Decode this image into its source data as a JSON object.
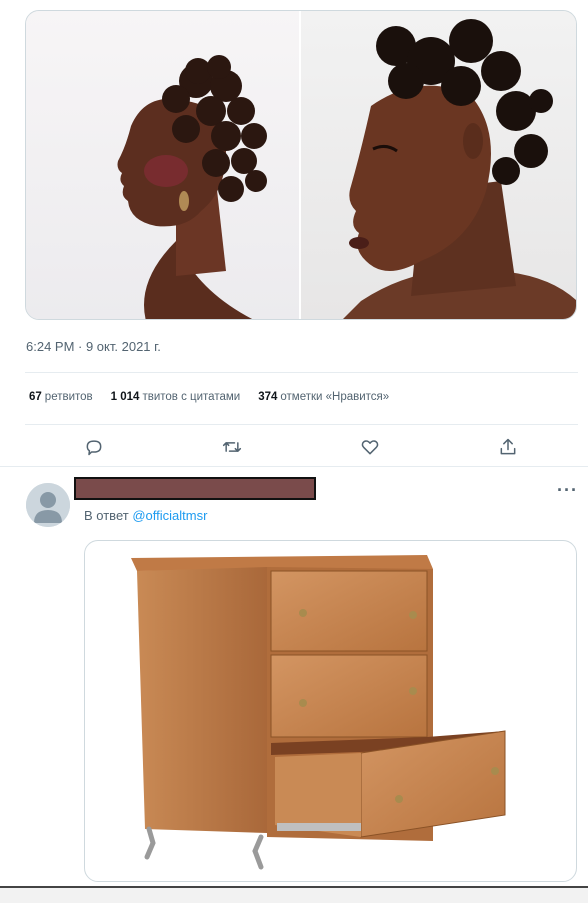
{
  "tweet": {
    "timestamp": "6:24 PM · 9 окт. 2021 г.",
    "stats": [
      {
        "count": "67",
        "label": "ретвитов"
      },
      {
        "count": "1 014",
        "label": "твитов с цитатами"
      },
      {
        "count": "374",
        "label": "отметки «Нравится»"
      }
    ],
    "actions": [
      {
        "name": "reply",
        "icon": "comment-icon"
      },
      {
        "name": "retweet",
        "icon": "retweet-icon"
      },
      {
        "name": "like",
        "icon": "heart-icon"
      },
      {
        "name": "share",
        "icon": "share-icon"
      }
    ],
    "images": [
      {
        "icon": "profile-photo-woman-bantu-knots"
      },
      {
        "icon": "profile-photo-woman-bantu-knots-2"
      }
    ]
  },
  "reply": {
    "prefix": "В ответ",
    "mention": "@officialtmsr",
    "more_label": "···",
    "image": {
      "icon": "dresser-open-drawer"
    }
  },
  "colors": {
    "link": "#1d9bf0",
    "muted": "#536471",
    "redaction": "#7a4b4b"
  }
}
